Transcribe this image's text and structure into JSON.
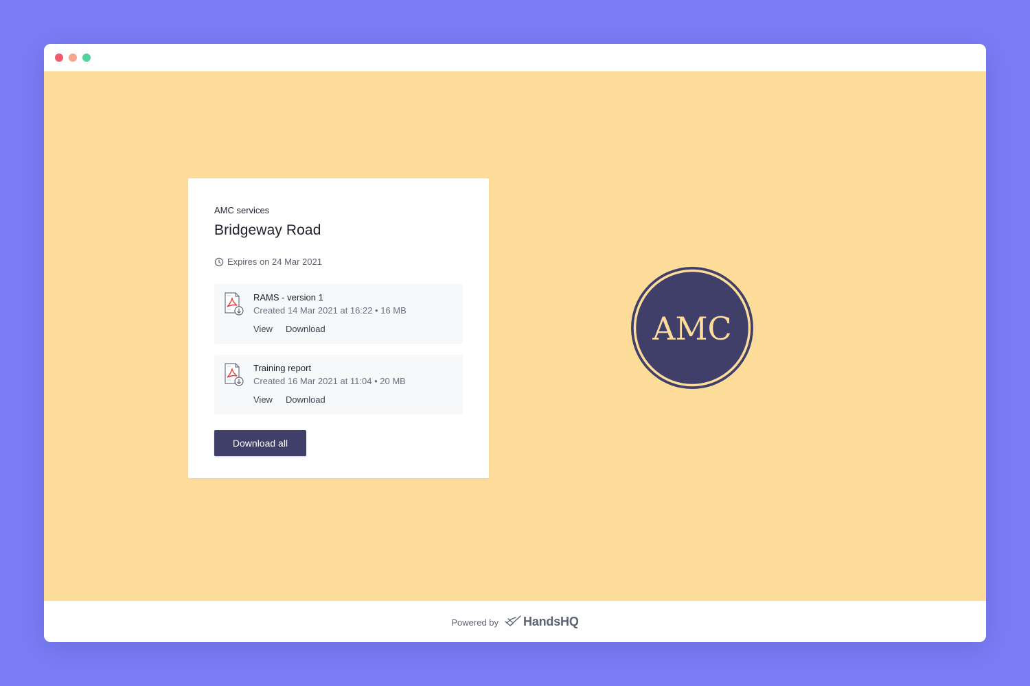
{
  "window": {
    "controls": [
      "close",
      "minimize",
      "maximize"
    ]
  },
  "card": {
    "company": "AMC services",
    "project_title": "Bridgeway Road",
    "expires_text": "Expires on 24 Mar 2021",
    "files": [
      {
        "name": "RAMS - version 1",
        "meta": "Created 14 Mar 2021 at 16:22 • 16 MB",
        "view_label": "View",
        "download_label": "Download",
        "icon": "pdf-download-icon"
      },
      {
        "name": "Training report",
        "meta": "Created 16 Mar 2021 at 11:04 • 20 MB",
        "view_label": "View",
        "download_label": "Download",
        "icon": "pdf-download-icon"
      }
    ],
    "download_all_label": "Download all"
  },
  "logo": {
    "text": "AMC"
  },
  "footer": {
    "powered_by": "Powered by",
    "brand_name": "HandsHQ"
  },
  "colors": {
    "page_background": "#7a7df5",
    "content_background": "#fedc9a",
    "primary_button": "#3f3f6a",
    "logo_fill": "#3f3f6a",
    "logo_accent": "#fedc9a"
  }
}
